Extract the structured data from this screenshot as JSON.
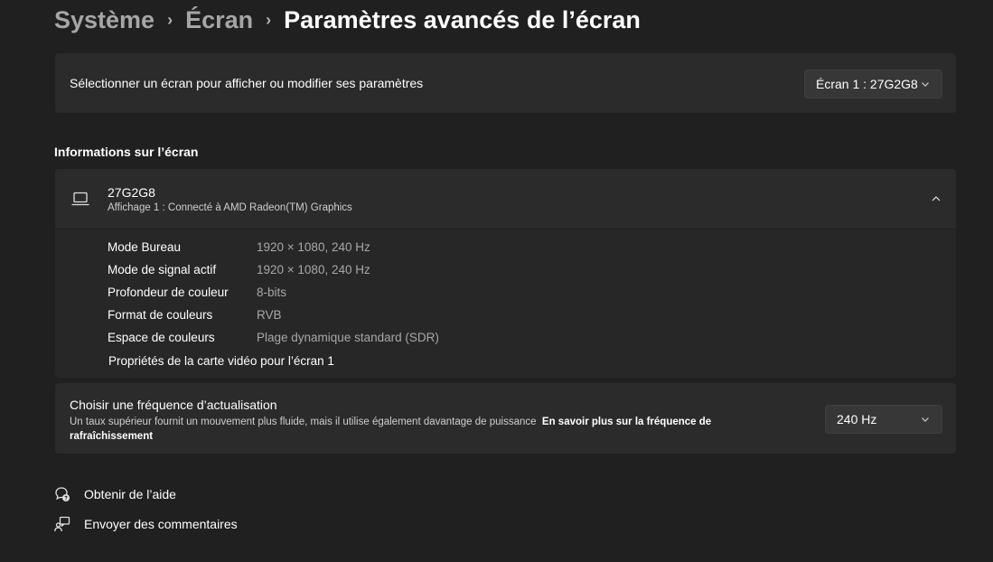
{
  "breadcrumb": {
    "items": [
      "Système",
      "Écran"
    ],
    "current": "Paramètres avancés de l’écran",
    "separator": "›"
  },
  "select_display": {
    "label": "Sélectionner un écran pour afficher ou modifier ses paramètres",
    "value": "Écran 1 : 27G2G8"
  },
  "info_section": {
    "title": "Informations sur l’écran",
    "display_name": "27G2G8",
    "display_sub": "Affichage 1 : Connecté à AMD Radeon(TM) Graphics",
    "rows": [
      {
        "key": "Mode Bureau",
        "value": "1920 × 1080, 240 Hz"
      },
      {
        "key": "Mode de signal actif",
        "value": "1920 × 1080, 240 Hz"
      },
      {
        "key": "Profondeur de couleur",
        "value": "8-bits"
      },
      {
        "key": "Format de couleurs",
        "value": "RVB"
      },
      {
        "key": "Espace de couleurs",
        "value": "Plage dynamique standard (SDR)"
      }
    ],
    "adapter_link": "Propriétés de la carte vidéo pour l’écran 1"
  },
  "refresh": {
    "title": "Choisir une fréquence d’actualisation",
    "description": "Un taux supérieur fournit un mouvement plus fluide, mais il utilise également davantage de puissance",
    "link": "En savoir plus sur la fréquence de rafraîchissement",
    "value": "240 Hz"
  },
  "footer": {
    "help": "Obtenir de l’aide",
    "feedback": "Envoyer des commentaires"
  },
  "icons": {
    "display": "laptop-icon",
    "expand": "chevron-up-icon",
    "dropdown": "chevron-down-icon",
    "help": "help-chat-icon",
    "feedback": "feedback-icon"
  }
}
